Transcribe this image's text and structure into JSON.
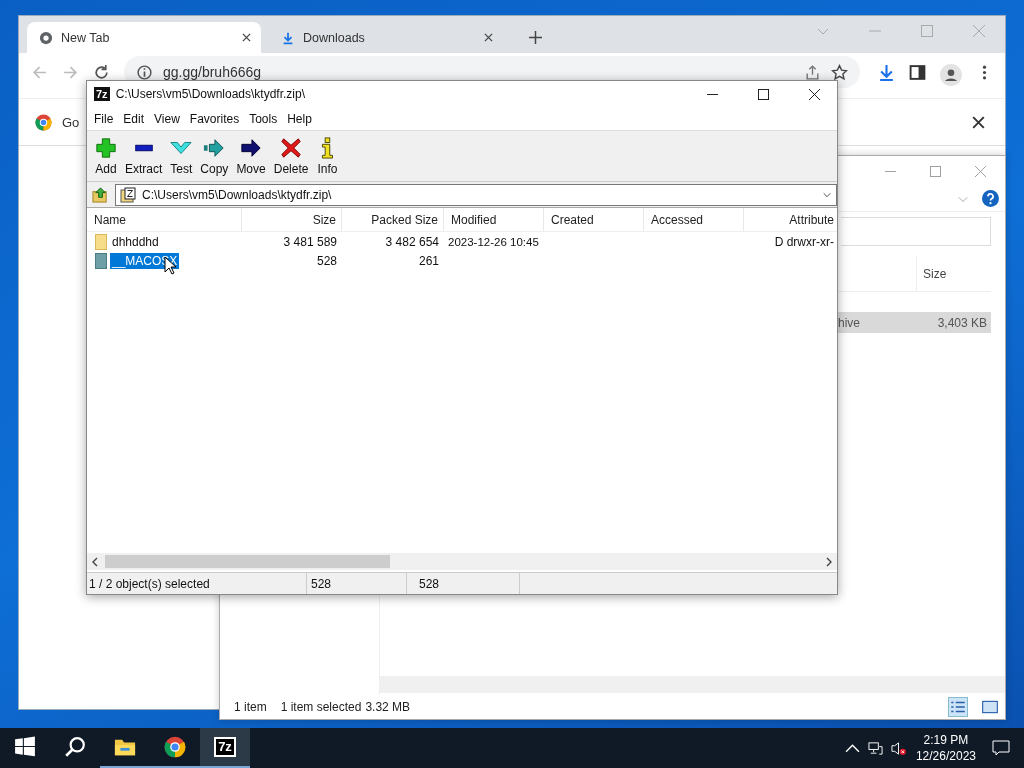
{
  "chrome": {
    "tabs": [
      {
        "title": "New Tab",
        "kind": "newtab",
        "selected": true
      },
      {
        "title": "Downloads",
        "kind": "downloads",
        "selected": false
      }
    ],
    "address": "gg.gg/bruh666g",
    "banner": {
      "text": "Go"
    }
  },
  "explorer": {
    "columns": [
      "Size"
    ],
    "rows": [
      {
        "column_1": "hive",
        "size": "3,403 KB",
        "selected": true
      }
    ],
    "status_bar": [
      "1 item",
      "1 item selected",
      "3.32 MB"
    ]
  },
  "sevenzip": {
    "title": "C:\\Users\\vm5\\Downloads\\ktydfr.zip\\",
    "logo": "7z",
    "menu": [
      "File",
      "Edit",
      "View",
      "Favorites",
      "Tools",
      "Help"
    ],
    "toolbar": [
      {
        "label": "Add",
        "kind": "add"
      },
      {
        "label": "Extract",
        "kind": "extract"
      },
      {
        "label": "Test",
        "kind": "test"
      },
      {
        "label": "Copy",
        "kind": "copy"
      },
      {
        "label": "Move",
        "kind": "move"
      },
      {
        "label": "Delete",
        "kind": "delete"
      },
      {
        "label": "Info",
        "kind": "info"
      }
    ],
    "address": "C:\\Users\\vm5\\Downloads\\ktydfr.zip\\",
    "columns": [
      "Name",
      "Size",
      "Packed Size",
      "Modified",
      "Created",
      "Accessed",
      "Attribute"
    ],
    "rows": [
      {
        "name": "dhhddhd",
        "size": "3 481 589",
        "packed_size": "3 482 654",
        "modified": "2023-12-26 10:45",
        "attributes": "D drwxr-xr-",
        "selected": false
      },
      {
        "name": "__MACOSX",
        "size": "528",
        "packed_size": "261",
        "modified": "",
        "attributes": "",
        "selected": true
      }
    ],
    "status_bar": [
      "1 / 2 object(s) selected",
      "528",
      "528"
    ]
  },
  "taskbar": {
    "items": [
      {
        "kind": "start",
        "running": false,
        "selected": false
      },
      {
        "kind": "search",
        "running": false,
        "selected": false
      },
      {
        "kind": "folder",
        "running": true,
        "selected": false
      },
      {
        "kind": "chrome",
        "running": true,
        "selected": false
      },
      {
        "kind": "sevenzip",
        "label": "7z",
        "running": true,
        "selected": true
      }
    ],
    "time": "2:19 PM",
    "date": "12/26/2023"
  }
}
